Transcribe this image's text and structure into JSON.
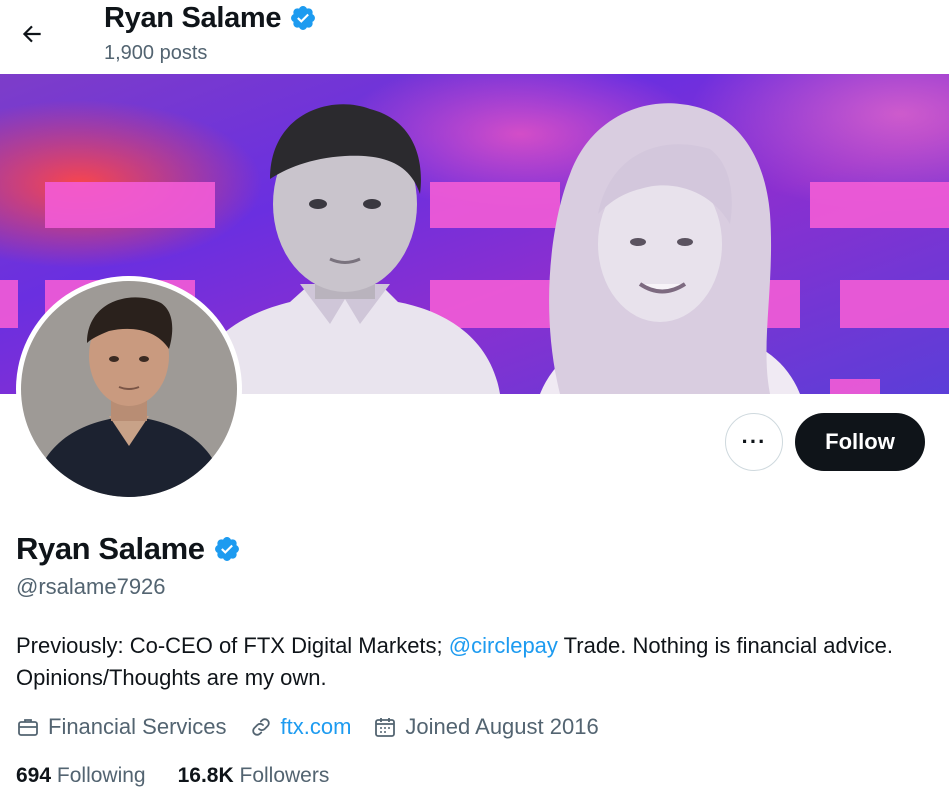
{
  "header": {
    "name": "Ryan Salame",
    "posts_count": "1,900 posts"
  },
  "actions": {
    "more_label": "···",
    "follow_label": "Follow"
  },
  "profile": {
    "display_name": "Ryan Salame",
    "handle": "@rsalame7926",
    "bio_before": "Previously: Co-CEO of FTX Digital Markets; ",
    "bio_mention": "@circlepay",
    "bio_after": " Trade. Nothing is financial advice. Opinions/Thoughts are my own.",
    "category": "Financial Services",
    "website": "ftx.com",
    "joined": "Joined August 2016"
  },
  "stats": {
    "following_count": "694",
    "following_label": "Following",
    "followers_count": "16.8K",
    "followers_label": "Followers"
  },
  "colors": {
    "accent": "#1d9bf0",
    "verified": "#1d9bf0",
    "text_primary": "#0f1419",
    "text_secondary": "#536471",
    "follow_bg": "#0f1419"
  },
  "icons": [
    "back-arrow-icon",
    "verified-badge-icon",
    "briefcase-icon",
    "link-icon",
    "calendar-icon"
  ]
}
